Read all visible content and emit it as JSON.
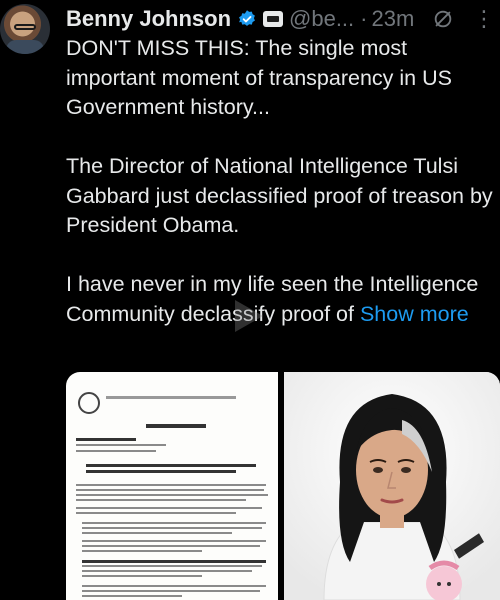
{
  "post": {
    "author_name": "Benny Johnson",
    "author_handle": "@be...",
    "separator": "·",
    "timestamp": "23m",
    "paragraphs": [
      "DON'T MISS THIS: The single most important moment of transparency in US Government history...",
      "The Director of National Intelligence Tulsi Gabbard just declassified proof of treason by President Obama."
    ],
    "truncated_paragraph": "I have never in my life seen the Intelligence Community declassify proof of",
    "show_more_label": "Show more"
  },
  "icons": {
    "verified": "verified-badge-icon",
    "affiliation": "affiliation-badge-icon",
    "grok": "grok-icon",
    "more": "more-icon",
    "play": "play-icon"
  },
  "colors": {
    "background": "#000000",
    "text": "#e7e9ea",
    "muted": "#71767b",
    "link": "#1d9bf0",
    "verified": "#1d9bf0"
  },
  "media": {
    "items": [
      "document-image",
      "photo-image"
    ]
  }
}
